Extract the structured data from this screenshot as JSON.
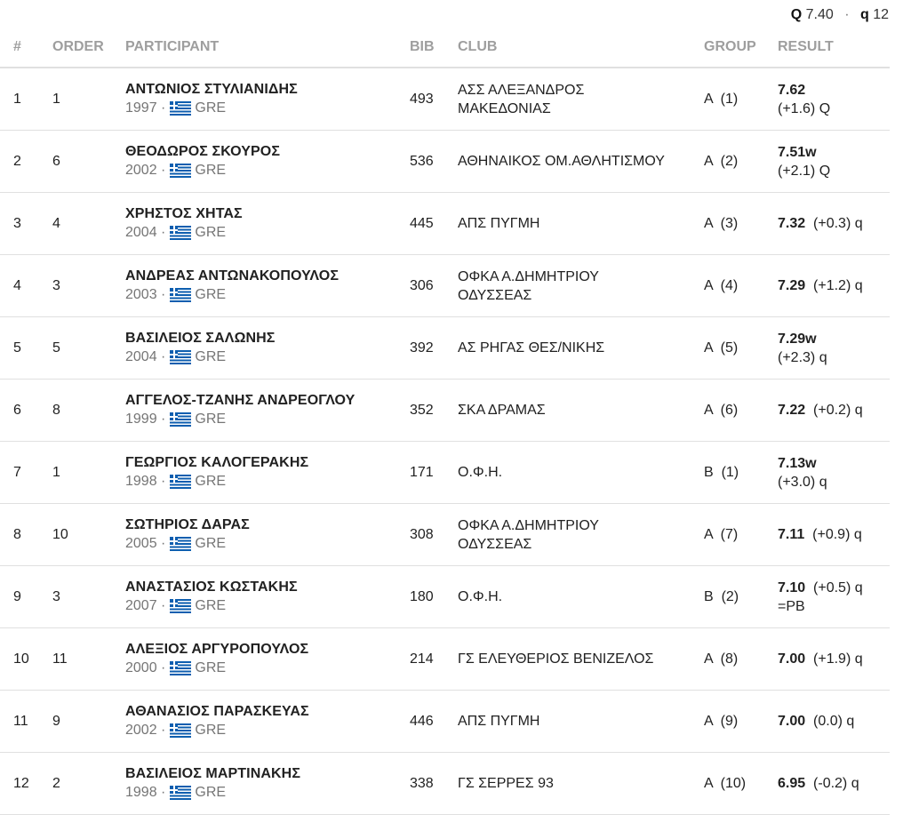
{
  "qualification": {
    "q_big_label": "Q",
    "q_big_value": "7.40",
    "separator": "·",
    "q_small_label": "q",
    "q_small_value": "12"
  },
  "headers": {
    "rank": "#",
    "order": "ORDER",
    "participant": "PARTICIPANT",
    "bib": "BIB",
    "club": "CLUB",
    "group": "GROUP",
    "result": "RESULT"
  },
  "rows": [
    {
      "rank": "1",
      "order": "1",
      "name": "ΑΝΤΩΝΙΟΣ ΣΤΥΛΙΑΝΙΔΗΣ",
      "year": "1997",
      "country": "GRE",
      "bib": "493",
      "club_lines": [
        "ΑΣΣ ΑΛΕΞΑΝΔΡΟΣ",
        "ΜΑΚΕΔΟΝΙΑΣ"
      ],
      "group": "Α  (1)",
      "mark": "7.62",
      "result_line1_rest": "",
      "result_line2": "(+1.6) Q"
    },
    {
      "rank": "2",
      "order": "6",
      "name": "ΘΕΟΔΩΡΟΣ ΣΚΟΥΡΟΣ",
      "year": "2002",
      "country": "GRE",
      "bib": "536",
      "club_lines": [
        "ΑΘΗΝΑΙΚΟΣ ΟΜ.ΑΘΛΗΤΙΣΜΟΥ"
      ],
      "group": "Α  (2)",
      "mark": "7.51w",
      "result_line1_rest": "",
      "result_line2": "(+2.1) Q"
    },
    {
      "rank": "3",
      "order": "4",
      "name": "ΧΡΗΣΤΟΣ ΧΗΤΑΣ",
      "year": "2004",
      "country": "GRE",
      "bib": "445",
      "club_lines": [
        "ΑΠΣ ΠΥΓΜΗ"
      ],
      "group": "Α  (3)",
      "mark": "7.32",
      "result_line1_rest": "(+0.3) q",
      "result_line2": ""
    },
    {
      "rank": "4",
      "order": "3",
      "name": "ΑΝΔΡΕΑΣ ΑΝΤΩΝΑΚΟΠΟΥΛΟΣ",
      "year": "2003",
      "country": "GRE",
      "bib": "306",
      "club_lines": [
        "ΟΦΚΑ Α.ΔΗΜΗΤΡΙΟΥ",
        "ΟΔΥΣΣΕΑΣ"
      ],
      "group": "Α  (4)",
      "mark": "7.29",
      "result_line1_rest": "(+1.2) q",
      "result_line2": ""
    },
    {
      "rank": "5",
      "order": "5",
      "name": "ΒΑΣΙΛΕΙΟΣ ΣΑΛΩΝΗΣ",
      "year": "2004",
      "country": "GRE",
      "bib": "392",
      "club_lines": [
        "ΑΣ ΡΗΓΑΣ ΘΕΣ/ΝΙΚΗΣ"
      ],
      "group": "Α  (5)",
      "mark": "7.29w",
      "result_line1_rest": "",
      "result_line2": "(+2.3) q"
    },
    {
      "rank": "6",
      "order": "8",
      "name": "ΑΓΓΕΛΟΣ-ΤΖΑΝΗΣ ΑΝΔΡΕΟΓΛΟΥ",
      "year": "1999",
      "country": "GRE",
      "bib": "352",
      "club_lines": [
        "ΣΚΑ ΔΡΑΜΑΣ"
      ],
      "group": "Α  (6)",
      "mark": "7.22",
      "result_line1_rest": "(+0.2) q",
      "result_line2": ""
    },
    {
      "rank": "7",
      "order": "1",
      "name": "ΓΕΩΡΓΙΟΣ ΚΑΛΟΓΕΡΑΚΗΣ",
      "year": "1998",
      "country": "GRE",
      "bib": "171",
      "club_lines": [
        "Ο.Φ.Η."
      ],
      "group": "Β  (1)",
      "mark": "7.13w",
      "result_line1_rest": "",
      "result_line2": "(+3.0) q"
    },
    {
      "rank": "8",
      "order": "10",
      "name": "ΣΩΤΗΡΙΟΣ ΔΑΡΑΣ",
      "year": "2005",
      "country": "GRE",
      "bib": "308",
      "club_lines": [
        "ΟΦΚΑ Α.ΔΗΜΗΤΡΙΟΥ",
        "ΟΔΥΣΣΕΑΣ"
      ],
      "group": "Α  (7)",
      "mark": "7.11",
      "result_line1_rest": "(+0.9) q",
      "result_line2": ""
    },
    {
      "rank": "9",
      "order": "3",
      "name": "ΑΝΑΣΤΑΣΙΟΣ ΚΩΣΤΑΚΗΣ",
      "year": "2007",
      "country": "GRE",
      "bib": "180",
      "club_lines": [
        "Ο.Φ.Η."
      ],
      "group": "Β  (2)",
      "mark": "7.10",
      "result_line1_rest": "(+0.5) q",
      "result_line2": "=PB"
    },
    {
      "rank": "10",
      "order": "11",
      "name": "ΑΛΕΞΙΟΣ ΑΡΓΥΡΟΠΟΥΛΟΣ",
      "year": "2000",
      "country": "GRE",
      "bib": "214",
      "club_lines": [
        "ΓΣ ΕΛΕΥΘΕΡΙΟΣ ΒΕΝΙΖΕΛΟΣ"
      ],
      "group": "Α  (8)",
      "mark": "7.00",
      "result_line1_rest": "(+1.9) q",
      "result_line2": ""
    },
    {
      "rank": "11",
      "order": "9",
      "name": "ΑΘΑΝΑΣΙΟΣ ΠΑΡΑΣΚΕΥΑΣ",
      "year": "2002",
      "country": "GRE",
      "bib": "446",
      "club_lines": [
        "ΑΠΣ ΠΥΓΜΗ"
      ],
      "group": "Α  (9)",
      "mark": "7.00",
      "result_line1_rest": "(0.0) q",
      "result_line2": ""
    },
    {
      "rank": "12",
      "order": "2",
      "name": "ΒΑΣΙΛΕΙΟΣ ΜΑΡΤΙΝΑΚΗΣ",
      "year": "1998",
      "country": "GRE",
      "bib": "338",
      "club_lines": [
        "ΓΣ ΣΕΡΡΕΣ 93"
      ],
      "group": "Α  (10)",
      "mark": "6.95",
      "result_line1_rest": "(-0.2) q",
      "result_line2": ""
    }
  ]
}
